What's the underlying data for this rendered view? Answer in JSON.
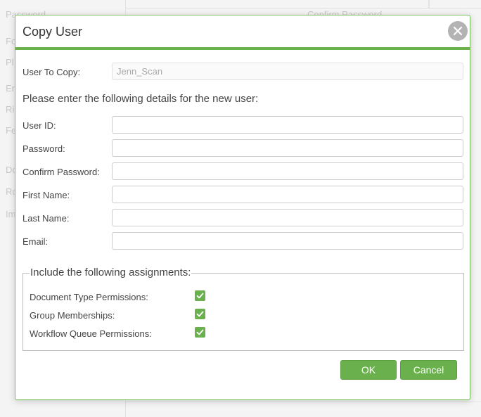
{
  "background": {
    "labels": [
      "Password",
      "Fo",
      "Pl",
      "En",
      "Ri",
      "Fe",
      "Do",
      "Ro",
      "Im",
      "Confirm Password"
    ]
  },
  "dialog": {
    "title": "Copy User",
    "close_icon": "close-icon",
    "user_to_copy_label": "User To Copy:",
    "user_to_copy_value": "Jenn_Scan",
    "instruction": "Please enter the following details for the new user:",
    "fields": {
      "user_id": {
        "label": "User ID:",
        "value": ""
      },
      "password": {
        "label": "Password:",
        "value": ""
      },
      "confirm_password": {
        "label": "Confirm Password:",
        "value": ""
      },
      "first_name": {
        "label": "First Name:",
        "value": ""
      },
      "last_name": {
        "label": "Last Name:",
        "value": ""
      },
      "email": {
        "label": "Email:",
        "value": ""
      }
    },
    "assignments": {
      "legend": "Include the following assignments:",
      "items": [
        {
          "label": "Document Type Permissions:",
          "checked": true
        },
        {
          "label": "Group Memberships:",
          "checked": true
        },
        {
          "label": "Workflow Queue Permissions:",
          "checked": true
        }
      ]
    },
    "buttons": {
      "ok": "OK",
      "cancel": "Cancel"
    }
  },
  "colors": {
    "accent": "#6ab04c",
    "close_button": "#b3b3b3",
    "text": "#444444"
  }
}
